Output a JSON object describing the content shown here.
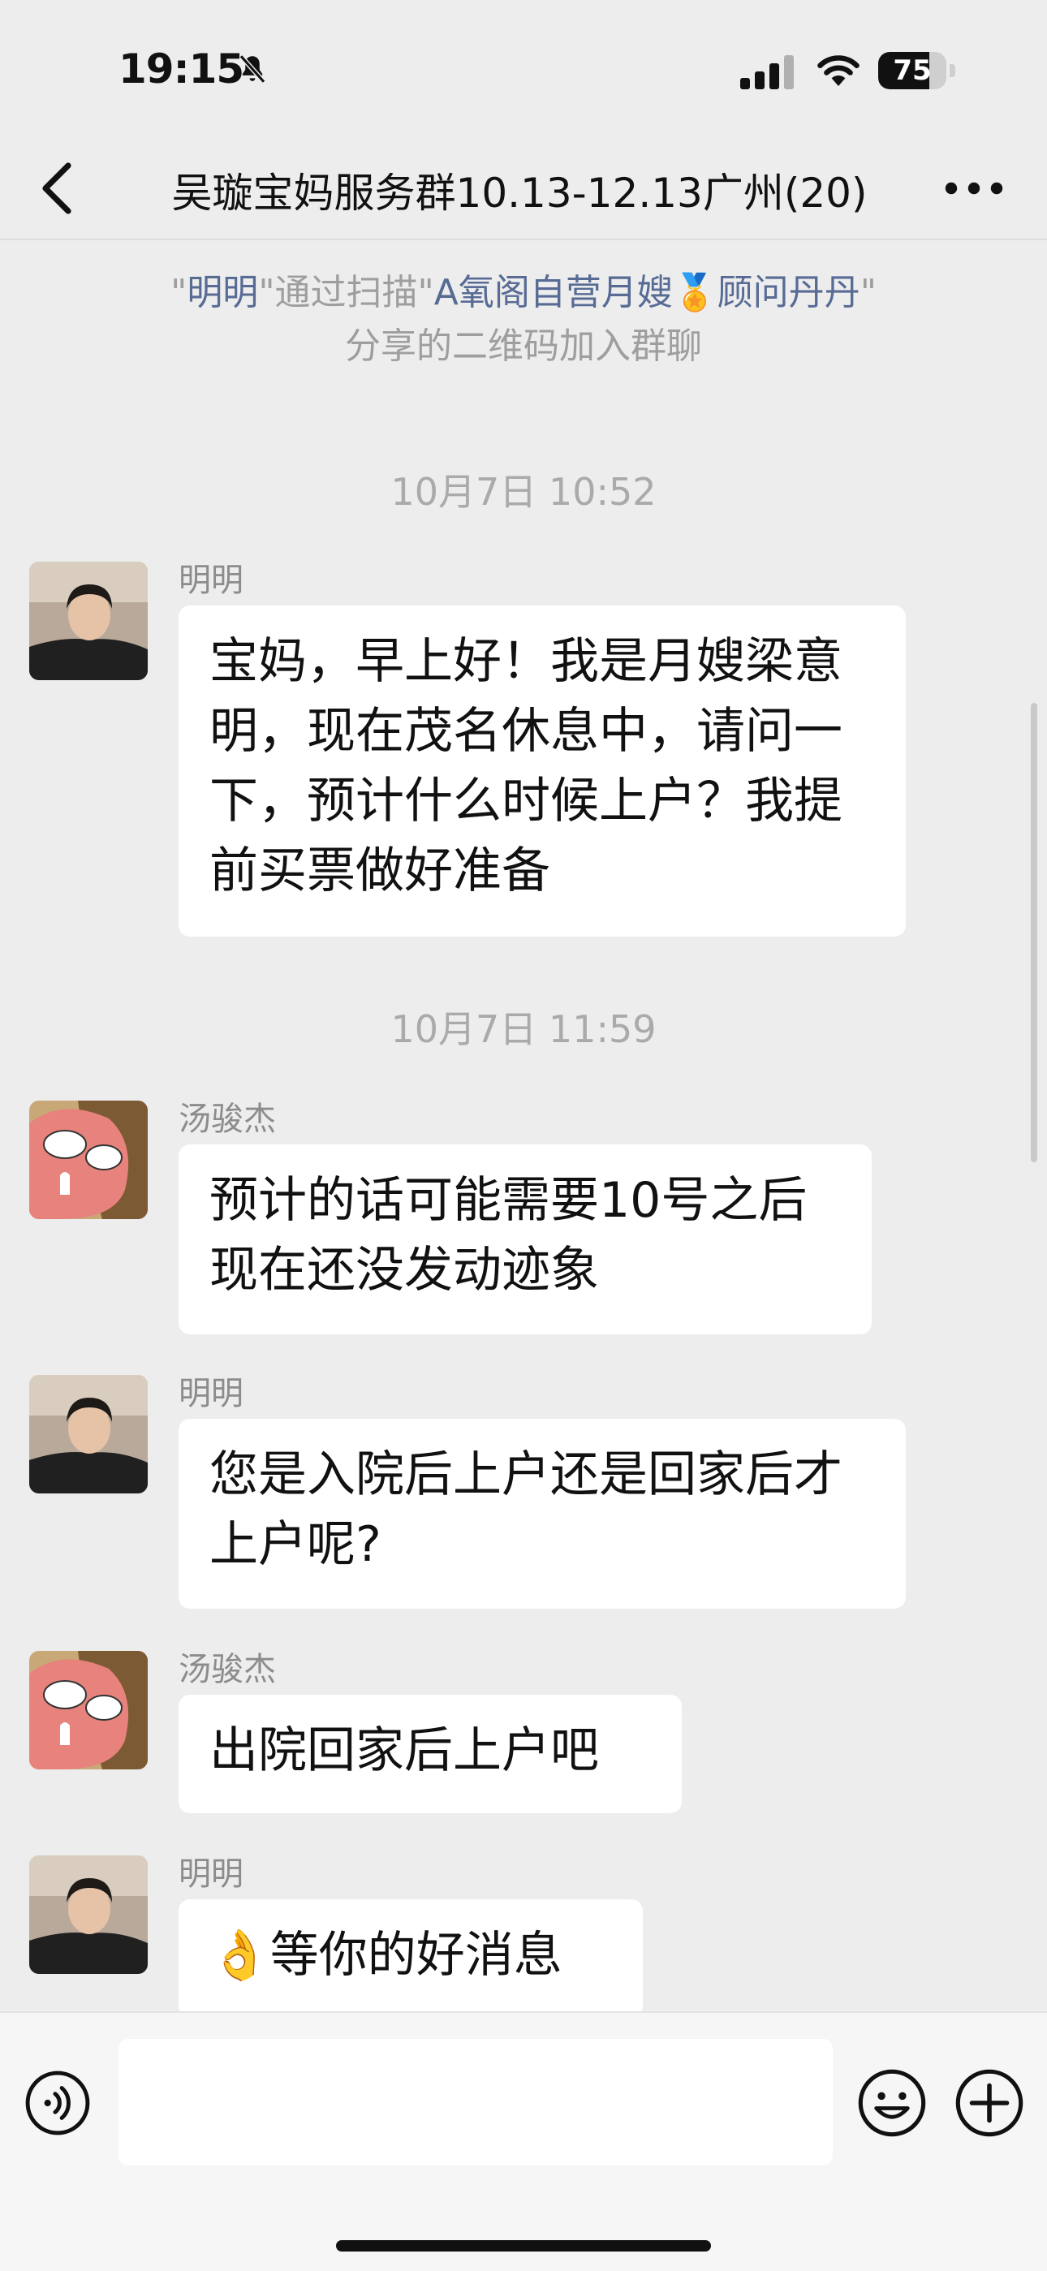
{
  "status_bar": {
    "time": "19:15",
    "battery_level": "75",
    "battery_fraction": 0.75
  },
  "nav": {
    "title": "吴璇宝妈服务群10.13-12.13广州(20)"
  },
  "system_notice": {
    "q1": "\"",
    "name1": "明明",
    "mid": "\"通过扫描\"",
    "name2": "A氧阁自营月嫂🏅顾问丹丹",
    "q2": "\"",
    "line2": "分享的二维码加入群聊"
  },
  "timestamps": [
    "10月7日 10:52",
    "10月7日 11:59"
  ],
  "messages": [
    {
      "sender": "明明",
      "text": "宝妈，早上好！我是月嫂梁意明，现在茂名休息中，请问一下，预计什么时候上户？我提前买票做好准备"
    },
    {
      "sender": "汤骏杰",
      "text": "预计的话可能需要10号之后现在还没发动迹象"
    },
    {
      "sender": "明明",
      "text": "您是入院后上户还是回家后才上户呢?"
    },
    {
      "sender": "汤骏杰",
      "text": "出院回家后上户吧"
    },
    {
      "sender": "明明",
      "emoji": "👌",
      "text": "等你的好消息"
    }
  ],
  "icons": {
    "bell": "bell-slash-icon",
    "signal": "cellular-signal-icon",
    "wifi": "wifi-icon",
    "back": "chevron-left-icon",
    "more": "ellipsis-icon",
    "voice": "voice-icon",
    "emoji": "emoji-face-icon",
    "plus": "plus-circle-icon"
  },
  "colors": {
    "background": "#ededed",
    "bubble": "#ffffff",
    "link_name": "#576b95",
    "meta_text": "#9e9e9e"
  }
}
